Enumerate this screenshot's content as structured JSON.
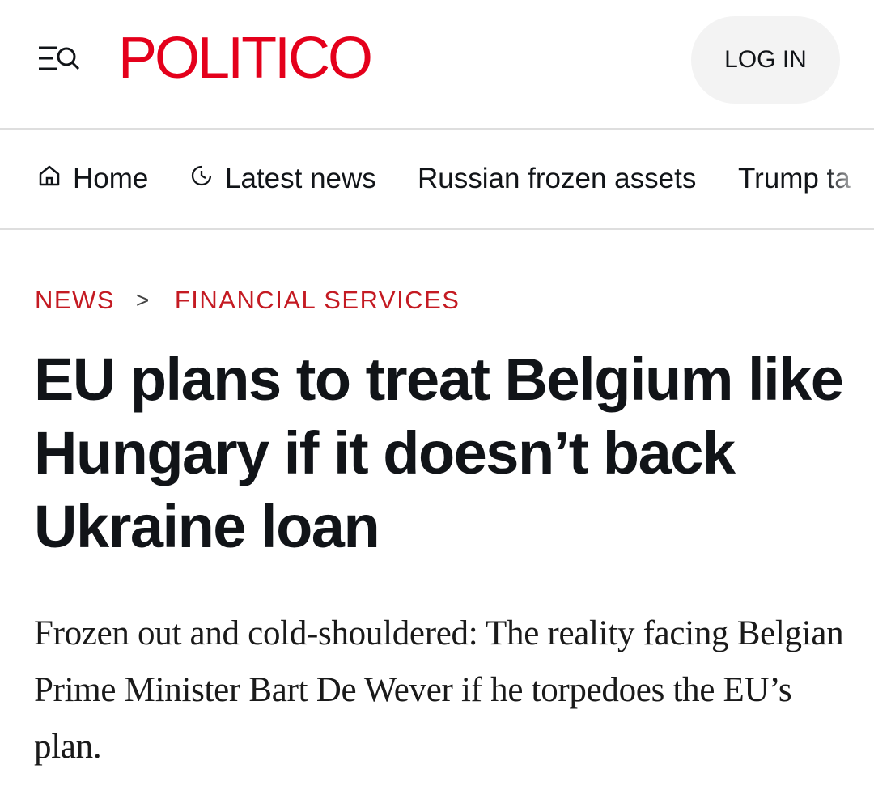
{
  "header": {
    "logo_text": "POLITICO",
    "login_label": "LOG IN",
    "menu_icon": "menu-search-icon",
    "brand_color": "#e4001b"
  },
  "nav": {
    "items": [
      {
        "label": "Home",
        "icon": "home-icon"
      },
      {
        "label": "Latest news",
        "icon": "clock-icon"
      },
      {
        "label": "Russian frozen assets"
      },
      {
        "label": "Trump ta"
      }
    ]
  },
  "breadcrumb": {
    "items": [
      "NEWS",
      "FINANCIAL SERVICES"
    ],
    "separator": ">",
    "color": "#c41a22"
  },
  "article": {
    "headline": "EU plans to treat Belgium like Hungary if it doesn’t back Ukraine loan",
    "dek": "Frozen out and cold-shouldered: The reality facing Belgian Prime Minister Bart De Wever if he torpedoes the EU’s plan."
  }
}
